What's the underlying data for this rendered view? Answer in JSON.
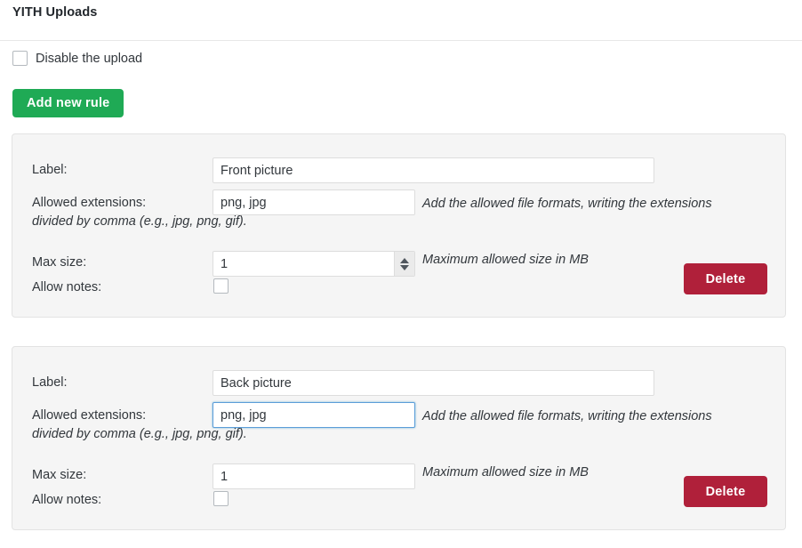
{
  "page": {
    "title": "YITH Uploads"
  },
  "disable_upload": {
    "label": "Disable the upload",
    "checked": false
  },
  "add_rule_button": {
    "label": "Add new rule"
  },
  "field_labels": {
    "label": "Label:",
    "allowed_extensions": "Allowed extensions:",
    "max_size": "Max size:",
    "allow_notes": "Allow notes:"
  },
  "hints": {
    "extensions_line1": "Add the allowed file formats, writing the extensions",
    "extensions_line2": "divided by comma (e.g., jpg, png, gif).",
    "max_size": "Maximum allowed size in MB"
  },
  "delete_button": {
    "label": "Delete"
  },
  "rules": [
    {
      "label_value": "Front picture",
      "extensions_value": "png, jpg",
      "max_size_value": "1",
      "allow_notes_checked": false,
      "extensions_focused": false,
      "has_spinner": true
    },
    {
      "label_value": "Back picture",
      "extensions_value": "png, jpg",
      "max_size_value": "1",
      "allow_notes_checked": false,
      "extensions_focused": true,
      "has_spinner": false
    }
  ],
  "colors": {
    "add_button": "#1faa55",
    "delete_button": "#b0203a",
    "box_background": "#f5f5f5",
    "box_border": "#e3e3e3",
    "focus_border": "#5b9dd9"
  }
}
